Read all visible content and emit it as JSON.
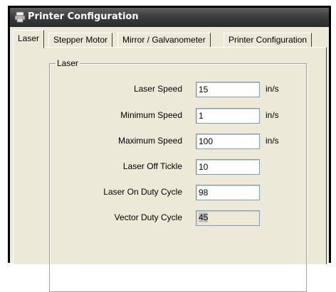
{
  "window": {
    "title": "Printer Configuration"
  },
  "tabs": [
    {
      "label": "Laser",
      "active": true
    },
    {
      "label": "Stepper Motor",
      "active": false
    },
    {
      "label": "Mirror / Galvanometer",
      "active": false
    },
    {
      "label": "Printer Configuration",
      "active": false
    }
  ],
  "groupbox": {
    "label": "Laser"
  },
  "fields": [
    {
      "label": "Laser Speed",
      "value": "15",
      "unit": "in/s"
    },
    {
      "label": "Minimum Speed",
      "value": "1",
      "unit": "in/s"
    },
    {
      "label": "Maximum Speed",
      "value": "100",
      "unit": "in/s"
    },
    {
      "label": "Laser Off Tickle",
      "value": "10",
      "unit": ""
    },
    {
      "label": "Laser On Duty Cycle",
      "value": "98",
      "unit": ""
    },
    {
      "label": "Vector Duty Cycle",
      "value": "45",
      "unit": "",
      "disabled": true
    }
  ],
  "icons": {
    "title": "printer-icon",
    "annotation": "arrow-icon"
  },
  "colors": {
    "titlebar": "#3c3d3f",
    "face": "#ece9d8",
    "annotation": "#000000"
  }
}
